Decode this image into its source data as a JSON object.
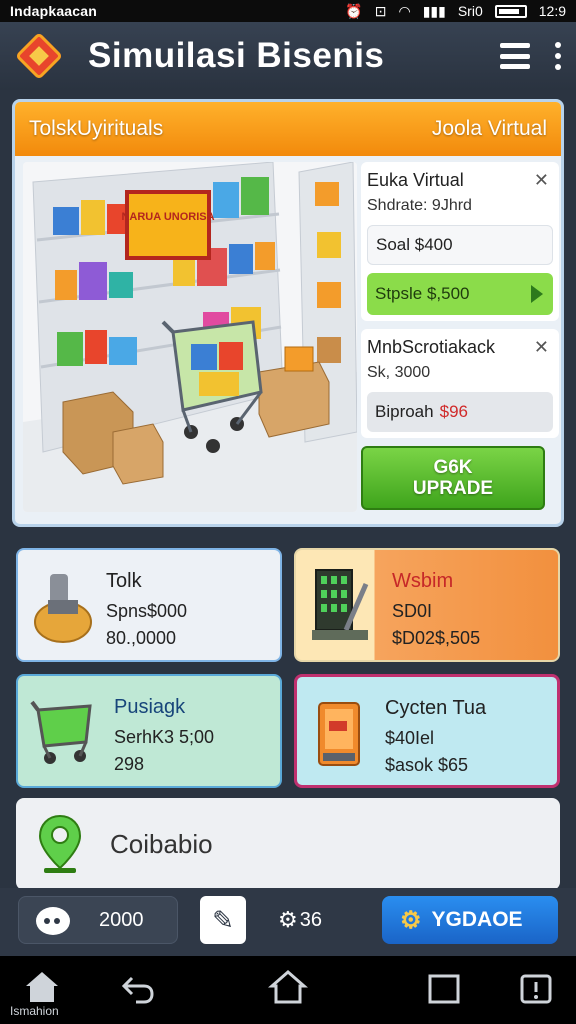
{
  "status_bar": {
    "left_text": "Indapkaacan",
    "signal_text": "Sri0",
    "time": "12:9"
  },
  "app_bar": {
    "title": "Simuilasi Bisenis"
  },
  "store": {
    "header_left": "TolskUyirituals",
    "header_right": "Joola Virtual",
    "sign_text": "NARUA UNORISA",
    "card1": {
      "title": "Euka Virtual",
      "subtitle": "Shdrate: 9Jhrd",
      "price": "Soal $400",
      "buy_label": "Stpsle $,500"
    },
    "card2": {
      "title": "MnbScrotiakack",
      "subtitle": "Sk, 3000",
      "price_prefix": "Biproah",
      "price_value": "$96"
    },
    "upgrade": {
      "line1": "G6K",
      "line2": "UPRADE"
    }
  },
  "stats": [
    {
      "title": "Tolk",
      "line1": "Spns$000",
      "line2": "80.,0000",
      "icon": "mixer-icon",
      "bg": "#edf1f6"
    },
    {
      "title": "Wsbim",
      "line1": "SD0I",
      "line2": "$D02$,505",
      "icon": "machine-icon",
      "bg": "#f6a45d"
    },
    {
      "title": "Pusiagk",
      "line1": "SerhK3 5;00",
      "line2": "298",
      "icon": "cart-icon",
      "bg": "#bfe8d5"
    },
    {
      "title": "Cycten Tua",
      "line1": "$40Iel",
      "line2": "$asok $65",
      "icon": "vending-icon",
      "bg": "#bfe9f1"
    }
  ],
  "banner": {
    "label": "Coibabio"
  },
  "toolbar": {
    "count_text": "2000",
    "settings_text": "36",
    "upgrade_label": "YGDAOE"
  },
  "nav": {
    "home_label": "Ismahion"
  },
  "colors": {
    "accent_orange": "#f28a0c",
    "accent_green": "#3fa41c",
    "accent_blue": "#1a64c7",
    "price_red": "#d02a2a"
  }
}
